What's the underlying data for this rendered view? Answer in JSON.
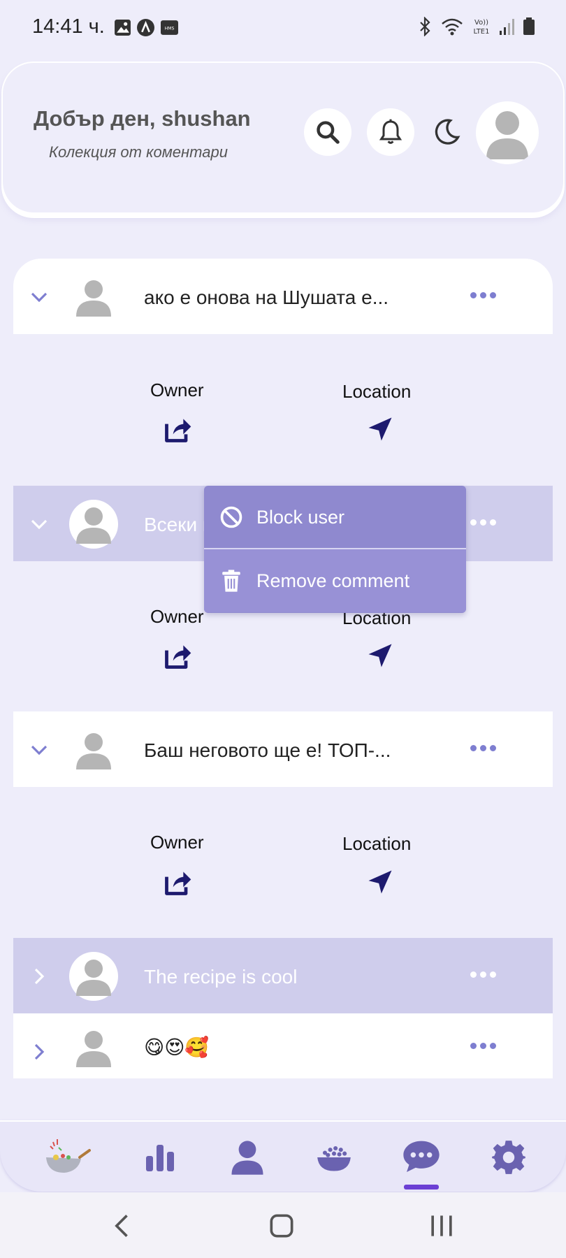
{
  "status_bar": {
    "time": "14:41 ч."
  },
  "header": {
    "greeting": "Добър ден, shushan",
    "subtitle": "Колекция от коментари"
  },
  "comments": [
    {
      "text": "ако е онова на Шушата е...",
      "blocked": false,
      "expanded": true
    },
    {
      "text": "Всеки път става различн...",
      "blocked": true,
      "expanded": true
    },
    {
      "text": "Баш неговото ще е! ТОП-...",
      "blocked": false,
      "expanded": true
    },
    {
      "text": "The recipe is cool",
      "blocked": true,
      "expanded": false
    },
    {
      "text": "😋😍🥰",
      "blocked": false,
      "expanded": false
    }
  ],
  "details": {
    "owner_label": "Owner",
    "location_label": "Location"
  },
  "context_menu": {
    "block_user": "Block user",
    "remove_comment": "Remove comment"
  },
  "colors": {
    "background": "#eeedfa",
    "accent": "#7e7ed0",
    "nav_icon": "#6a62b0",
    "dark_icon": "#1d1a6e",
    "menu": "#8f89cf",
    "active_indicator": "#6b3fd4"
  },
  "bottom_nav": {
    "items": [
      "wok-logo-icon",
      "stats-icon",
      "profile-icon",
      "recipes-bowl-icon",
      "comments-icon",
      "settings-icon"
    ],
    "active": "comments-icon"
  }
}
